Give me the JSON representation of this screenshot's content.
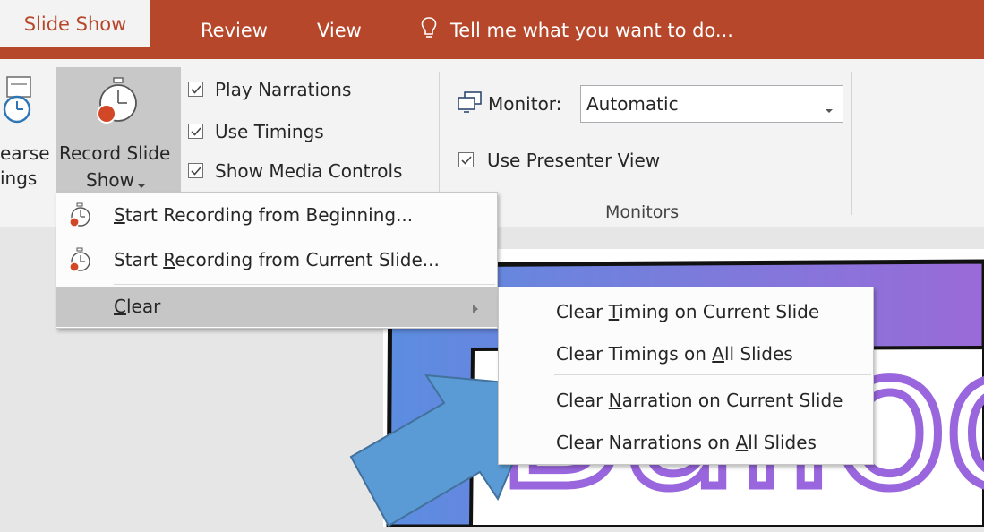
{
  "tabs": {
    "slide_show": "Slide Show",
    "review": "Review",
    "view": "View",
    "tell_me": "Tell me what you want to do..."
  },
  "ribbon": {
    "rehearse_line1": "earse",
    "rehearse_line2": "ings",
    "record_line1": "Record Slide",
    "record_line2": "Show",
    "play_narrations": "Play Narrations",
    "use_timings": "Use Timings",
    "show_media_controls": "Show Media Controls",
    "monitor_label": "Monitor:",
    "monitor_value": "Automatic",
    "use_presenter_view": "Use Presenter View",
    "monitors_group": "Monitors"
  },
  "menu": {
    "start_beginning": {
      "pre": "",
      "key": "S",
      "post": "tart Recording from Beginning..."
    },
    "start_current": {
      "pre": "Start ",
      "key": "R",
      "post": "ecording from Current Slide..."
    },
    "clear": {
      "pre": "",
      "key": "C",
      "post": "lear"
    }
  },
  "submenu": {
    "clear_timing_current": {
      "pre": "Clear ",
      "key": "T",
      "post": "iming on Current Slide"
    },
    "clear_timings_all": {
      "pre": "Clear Timings on ",
      "key": "A",
      "post": "ll Slides"
    },
    "clear_narration_current": {
      "pre": "Clear ",
      "key": "N",
      "post": "arration on Current Slide"
    },
    "clear_narrations_all": {
      "pre": "Clear Narrations on ",
      "key": "A",
      "post": "ll Slides"
    }
  },
  "slide": {
    "text": "Balloo"
  },
  "colors": {
    "accent": "#b7472a",
    "arrow": "#5b9bd5",
    "balloon_text": "#9966dd",
    "slide_gradient_start": "#5b8de0",
    "slide_gradient_end": "#9a6ad8"
  }
}
